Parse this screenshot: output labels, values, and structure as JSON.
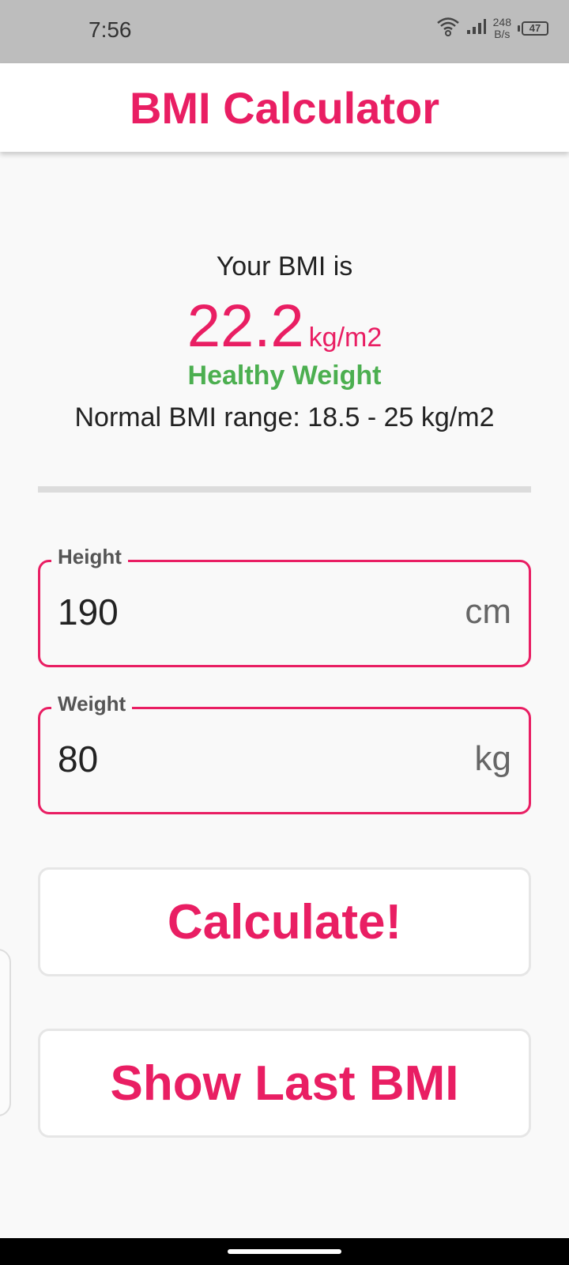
{
  "status_bar": {
    "time": "7:56",
    "net_speed_value": "248",
    "net_speed_unit": "B/s",
    "battery": "47"
  },
  "app_bar": {
    "title": "BMI Calculator"
  },
  "result": {
    "label": "Your BMI is",
    "value": "22.2",
    "unit": "kg/m2",
    "status": "Healthy Weight",
    "range": "Normal BMI range: 18.5 - 25 kg/m2"
  },
  "height_field": {
    "label": "Height",
    "value": "190",
    "suffix": "cm"
  },
  "weight_field": {
    "label": "Weight",
    "value": "80",
    "suffix": "kg"
  },
  "buttons": {
    "calculate": "Calculate!",
    "show_last": "Show Last BMI"
  },
  "colors": {
    "accent": "#e91e63",
    "healthy": "#4caf50",
    "status_bar": "#bdbdbd"
  }
}
